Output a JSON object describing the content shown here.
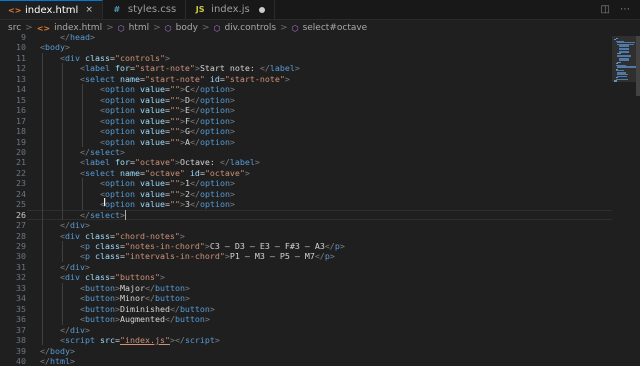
{
  "tabs": [
    {
      "label": "index.html",
      "icon": "<>",
      "kind": "html",
      "active": true,
      "close": "×"
    },
    {
      "label": "styles.css",
      "icon": "#",
      "kind": "css",
      "active": false
    },
    {
      "label": "index.js",
      "icon": "JS",
      "kind": "js",
      "active": false,
      "modified": true
    }
  ],
  "breadcrumb": [
    {
      "label": "src",
      "icon": ""
    },
    {
      "label": "index.html",
      "icon": "<>",
      "kind": "html"
    },
    {
      "label": "html",
      "icon": "⬡",
      "kind": "box"
    },
    {
      "label": "body",
      "icon": "⬡",
      "kind": "box"
    },
    {
      "label": "div.controls",
      "icon": "⬡",
      "kind": "box"
    },
    {
      "label": "select#octave",
      "icon": "⬡",
      "kind": "box"
    }
  ],
  "breadcrumb_separator": ">",
  "editor": {
    "current_line": 26,
    "lines": [
      {
        "n": "9",
        "indent": 1,
        "segs": [
          [
            "p",
            "</"
          ],
          [
            "t",
            "head"
          ],
          [
            "p",
            ">"
          ]
        ]
      },
      {
        "n": "10",
        "indent": 0,
        "segs": [
          [
            "p",
            "<"
          ],
          [
            "t",
            "body"
          ],
          [
            "p",
            ">"
          ]
        ]
      },
      {
        "n": "11",
        "indent": 1,
        "segs": [
          [
            "p",
            "<"
          ],
          [
            "t",
            "div"
          ],
          [
            "x",
            " "
          ],
          [
            "a",
            "class"
          ],
          [
            "x",
            "="
          ],
          [
            "s",
            "\"controls\""
          ],
          [
            "p",
            ">"
          ]
        ]
      },
      {
        "n": "12",
        "indent": 2,
        "segs": [
          [
            "p",
            "<"
          ],
          [
            "t",
            "label"
          ],
          [
            "x",
            " "
          ],
          [
            "a",
            "for"
          ],
          [
            "x",
            "="
          ],
          [
            "s",
            "\"start-note\""
          ],
          [
            "p",
            ">"
          ],
          [
            "x",
            "Start note: "
          ],
          [
            "p",
            "</"
          ],
          [
            "t",
            "label"
          ],
          [
            "p",
            ">"
          ]
        ]
      },
      {
        "n": "13",
        "indent": 2,
        "segs": [
          [
            "p",
            "<"
          ],
          [
            "t",
            "select"
          ],
          [
            "x",
            " "
          ],
          [
            "a",
            "name"
          ],
          [
            "x",
            "="
          ],
          [
            "s",
            "\"start-note\""
          ],
          [
            "x",
            " "
          ],
          [
            "a",
            "id"
          ],
          [
            "x",
            "="
          ],
          [
            "s",
            "\"start-note\""
          ],
          [
            "p",
            ">"
          ]
        ]
      },
      {
        "n": "14",
        "indent": 3,
        "segs": [
          [
            "p",
            "<"
          ],
          [
            "t",
            "option"
          ],
          [
            "x",
            " "
          ],
          [
            "a",
            "value"
          ],
          [
            "x",
            "="
          ],
          [
            "s",
            "\"\""
          ],
          [
            "p",
            ">"
          ],
          [
            "x",
            "C"
          ],
          [
            "p",
            "</"
          ],
          [
            "t",
            "option"
          ],
          [
            "p",
            ">"
          ]
        ]
      },
      {
        "n": "15",
        "indent": 3,
        "segs": [
          [
            "p",
            "<"
          ],
          [
            "t",
            "option"
          ],
          [
            "x",
            " "
          ],
          [
            "a",
            "value"
          ],
          [
            "x",
            "="
          ],
          [
            "s",
            "\"\""
          ],
          [
            "p",
            ">"
          ],
          [
            "x",
            "D"
          ],
          [
            "p",
            "</"
          ],
          [
            "t",
            "option"
          ],
          [
            "p",
            ">"
          ]
        ]
      },
      {
        "n": "16",
        "indent": 3,
        "segs": [
          [
            "p",
            "<"
          ],
          [
            "t",
            "option"
          ],
          [
            "x",
            " "
          ],
          [
            "a",
            "value"
          ],
          [
            "x",
            "="
          ],
          [
            "s",
            "\"\""
          ],
          [
            "p",
            ">"
          ],
          [
            "x",
            "E"
          ],
          [
            "p",
            "</"
          ],
          [
            "t",
            "option"
          ],
          [
            "p",
            ">"
          ]
        ]
      },
      {
        "n": "17",
        "indent": 3,
        "segs": [
          [
            "p",
            "<"
          ],
          [
            "t",
            "option"
          ],
          [
            "x",
            " "
          ],
          [
            "a",
            "value"
          ],
          [
            "x",
            "="
          ],
          [
            "s",
            "\"\""
          ],
          [
            "p",
            ">"
          ],
          [
            "x",
            "F"
          ],
          [
            "p",
            "</"
          ],
          [
            "t",
            "option"
          ],
          [
            "p",
            ">"
          ]
        ]
      },
      {
        "n": "18",
        "indent": 3,
        "segs": [
          [
            "p",
            "<"
          ],
          [
            "t",
            "option"
          ],
          [
            "x",
            " "
          ],
          [
            "a",
            "value"
          ],
          [
            "x",
            "="
          ],
          [
            "s",
            "\"\""
          ],
          [
            "p",
            ">"
          ],
          [
            "x",
            "G"
          ],
          [
            "p",
            "</"
          ],
          [
            "t",
            "option"
          ],
          [
            "p",
            ">"
          ]
        ]
      },
      {
        "n": "19",
        "indent": 3,
        "segs": [
          [
            "p",
            "<"
          ],
          [
            "t",
            "option"
          ],
          [
            "x",
            " "
          ],
          [
            "a",
            "value"
          ],
          [
            "x",
            "="
          ],
          [
            "s",
            "\"\""
          ],
          [
            "p",
            ">"
          ],
          [
            "x",
            "A"
          ],
          [
            "p",
            "</"
          ],
          [
            "t",
            "option"
          ],
          [
            "p",
            ">"
          ]
        ]
      },
      {
        "n": "20",
        "indent": 2,
        "segs": [
          [
            "p",
            "</"
          ],
          [
            "t",
            "select"
          ],
          [
            "p",
            ">"
          ]
        ]
      },
      {
        "n": "21",
        "indent": 2,
        "segs": [
          [
            "p",
            "<"
          ],
          [
            "t",
            "label"
          ],
          [
            "x",
            " "
          ],
          [
            "a",
            "for"
          ],
          [
            "x",
            "="
          ],
          [
            "s",
            "\"octave\""
          ],
          [
            "p",
            ">"
          ],
          [
            "x",
            "Octave: "
          ],
          [
            "p",
            "</"
          ],
          [
            "t",
            "label"
          ],
          [
            "p",
            ">"
          ]
        ]
      },
      {
        "n": "22",
        "indent": 2,
        "segs": [
          [
            "p",
            "<"
          ],
          [
            "t",
            "select"
          ],
          [
            "x",
            " "
          ],
          [
            "a",
            "name"
          ],
          [
            "x",
            "="
          ],
          [
            "s",
            "\"octave\""
          ],
          [
            "x",
            " "
          ],
          [
            "a",
            "id"
          ],
          [
            "x",
            "="
          ],
          [
            "s",
            "\"octave\""
          ],
          [
            "p",
            ">"
          ]
        ]
      },
      {
        "n": "23",
        "indent": 3,
        "segs": [
          [
            "p",
            "<"
          ],
          [
            "t",
            "option"
          ],
          [
            "x",
            " "
          ],
          [
            "a",
            "value"
          ],
          [
            "x",
            "="
          ],
          [
            "s",
            "\"\""
          ],
          [
            "p",
            ">"
          ],
          [
            "x",
            "1"
          ],
          [
            "p",
            "</"
          ],
          [
            "t",
            "option"
          ],
          [
            "p",
            ">"
          ]
        ]
      },
      {
        "n": "24",
        "indent": 3,
        "segs": [
          [
            "p",
            "<"
          ],
          [
            "t",
            "option"
          ],
          [
            "x",
            " "
          ],
          [
            "a",
            "value"
          ],
          [
            "x",
            "="
          ],
          [
            "s",
            "\"\""
          ],
          [
            "p",
            ">"
          ],
          [
            "x",
            "2"
          ],
          [
            "p",
            "</"
          ],
          [
            "t",
            "option"
          ],
          [
            "p",
            ">"
          ]
        ]
      },
      {
        "n": "25",
        "indent": 3,
        "segs": [
          [
            "p",
            "<"
          ],
          [
            "t",
            "option"
          ],
          [
            "x",
            " "
          ],
          [
            "a",
            "value"
          ],
          [
            "x",
            "="
          ],
          [
            "s",
            "\"\""
          ],
          [
            "p",
            ">"
          ],
          [
            "x",
            "3"
          ],
          [
            "p",
            "</"
          ],
          [
            "t",
            "option"
          ],
          [
            "p",
            ">"
          ]
        ]
      },
      {
        "n": "26",
        "indent": 2,
        "segs": [
          [
            "p",
            "</"
          ],
          [
            "t",
            "select"
          ],
          [
            "p",
            ">"
          ]
        ]
      },
      {
        "n": "27",
        "indent": 1,
        "segs": [
          [
            "p",
            "</"
          ],
          [
            "t",
            "div"
          ],
          [
            "p",
            ">"
          ]
        ]
      },
      {
        "n": "28",
        "indent": 1,
        "segs": [
          [
            "p",
            "<"
          ],
          [
            "t",
            "div"
          ],
          [
            "x",
            " "
          ],
          [
            "a",
            "class"
          ],
          [
            "x",
            "="
          ],
          [
            "s",
            "\"chord-notes\""
          ],
          [
            "p",
            ">"
          ]
        ]
      },
      {
        "n": "29",
        "indent": 2,
        "segs": [
          [
            "p",
            "<"
          ],
          [
            "t",
            "p"
          ],
          [
            "x",
            " "
          ],
          [
            "a",
            "class"
          ],
          [
            "x",
            "="
          ],
          [
            "s",
            "\"notes-in-chord\""
          ],
          [
            "p",
            ">"
          ],
          [
            "x",
            "C3 – D3 – E3 – F#3 – A3"
          ],
          [
            "p",
            "</"
          ],
          [
            "t",
            "p"
          ],
          [
            "p",
            ">"
          ]
        ]
      },
      {
        "n": "30",
        "indent": 2,
        "segs": [
          [
            "p",
            "<"
          ],
          [
            "t",
            "p"
          ],
          [
            "x",
            " "
          ],
          [
            "a",
            "class"
          ],
          [
            "x",
            "="
          ],
          [
            "s",
            "\"intervals-in-chord\""
          ],
          [
            "p",
            ">"
          ],
          [
            "x",
            "P1 – M3 – P5 – M7"
          ],
          [
            "p",
            "</"
          ],
          [
            "t",
            "p"
          ],
          [
            "p",
            ">"
          ]
        ]
      },
      {
        "n": "31",
        "indent": 1,
        "segs": [
          [
            "p",
            "</"
          ],
          [
            "t",
            "div"
          ],
          [
            "p",
            ">"
          ]
        ]
      },
      {
        "n": "32",
        "indent": 1,
        "segs": [
          [
            "p",
            "<"
          ],
          [
            "t",
            "div"
          ],
          [
            "x",
            " "
          ],
          [
            "a",
            "class"
          ],
          [
            "x",
            "="
          ],
          [
            "s",
            "\"buttons\""
          ],
          [
            "p",
            ">"
          ]
        ]
      },
      {
        "n": "33",
        "indent": 2,
        "segs": [
          [
            "p",
            "<"
          ],
          [
            "t",
            "button"
          ],
          [
            "p",
            ">"
          ],
          [
            "x",
            "Major"
          ],
          [
            "p",
            "</"
          ],
          [
            "t",
            "button"
          ],
          [
            "p",
            ">"
          ]
        ]
      },
      {
        "n": "34",
        "indent": 2,
        "segs": [
          [
            "p",
            "<"
          ],
          [
            "t",
            "button"
          ],
          [
            "p",
            ">"
          ],
          [
            "x",
            "Minor"
          ],
          [
            "p",
            "</"
          ],
          [
            "t",
            "button"
          ],
          [
            "p",
            ">"
          ]
        ]
      },
      {
        "n": "35",
        "indent": 2,
        "segs": [
          [
            "p",
            "<"
          ],
          [
            "t",
            "button"
          ],
          [
            "p",
            ">"
          ],
          [
            "x",
            "Diminished"
          ],
          [
            "p",
            "</"
          ],
          [
            "t",
            "button"
          ],
          [
            "p",
            ">"
          ]
        ]
      },
      {
        "n": "36",
        "indent": 2,
        "segs": [
          [
            "p",
            "<"
          ],
          [
            "t",
            "button"
          ],
          [
            "p",
            ">"
          ],
          [
            "x",
            "Augmented"
          ],
          [
            "p",
            "</"
          ],
          [
            "t",
            "button"
          ],
          [
            "p",
            ">"
          ]
        ]
      },
      {
        "n": "37",
        "indent": 1,
        "segs": [
          [
            "p",
            "</"
          ],
          [
            "t",
            "div"
          ],
          [
            "p",
            ">"
          ]
        ]
      },
      {
        "n": "38",
        "indent": 1,
        "segs": [
          [
            "p",
            "<"
          ],
          [
            "t",
            "script"
          ],
          [
            "x",
            " "
          ],
          [
            "a",
            "src"
          ],
          [
            "x",
            "="
          ],
          [
            "s",
            "\"index.js\""
          ],
          [
            "p",
            ">"
          ],
          [
            "p",
            "</"
          ],
          [
            "t",
            "script"
          ],
          [
            "p",
            ">"
          ]
        ]
      },
      {
        "n": "39",
        "indent": 0,
        "segs": [
          [
            "p",
            "</"
          ],
          [
            "t",
            "body"
          ],
          [
            "p",
            ">"
          ]
        ]
      },
      {
        "n": "40",
        "indent": 0,
        "segs": [
          [
            "p",
            "</"
          ],
          [
            "t",
            "html"
          ],
          [
            "p",
            ">"
          ]
        ]
      }
    ]
  },
  "icons": {
    "close": "close-icon",
    "modified": "unsaved-dot-icon",
    "split": "split-editor-icon",
    "more": "more-actions-icon"
  },
  "colors": {
    "tag": "#569cd6",
    "attr": "#9cdcfe",
    "string": "#ce9178",
    "punct": "#808080",
    "text": "#d4d4d4",
    "active_tab_accent": "#0078d4"
  }
}
